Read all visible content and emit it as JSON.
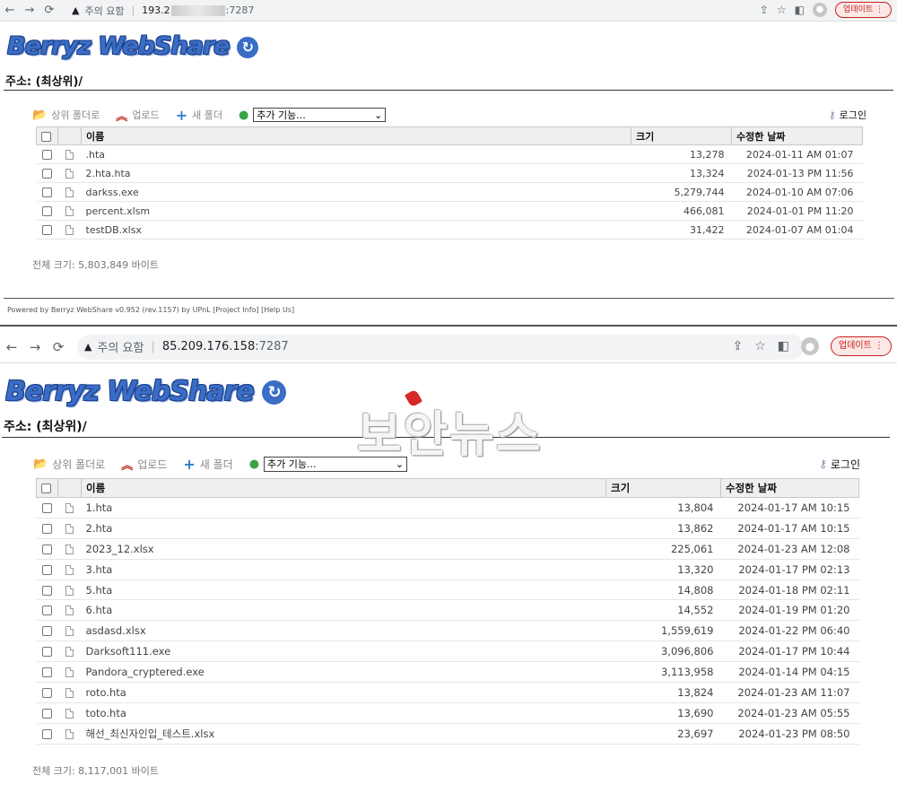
{
  "shot1": {
    "browser": {
      "nav": {
        "back": "←",
        "forward": "→",
        "reload": "⟳"
      },
      "warning_label": "주의 요함",
      "host": "193.2",
      "port": ":7287",
      "update_label": "업데이트",
      "menu": "⋮"
    },
    "logo": {
      "text": "Berryz WebShare",
      "swirl": "↻"
    },
    "address": "주소: (최상위)/",
    "toolbar": {
      "parent": "상위 폴더로",
      "upload": "업로드",
      "new_folder": "새 폴더",
      "more": "추가 기능...",
      "login": "로그인"
    },
    "table": {
      "headers": {
        "name": "이름",
        "size": "크기",
        "date": "수정한 날짜"
      },
      "rows": [
        {
          "name": ".hta",
          "size": "13,278",
          "date": "2024-01-11 AM 01:07"
        },
        {
          "name": "2.hta.hta",
          "size": "13,324",
          "date": "2024-01-13 PM 11:56"
        },
        {
          "name": "darkss.exe",
          "size": "5,279,744",
          "date": "2024-01-10 AM 07:06"
        },
        {
          "name": "percent.xlsm",
          "size": "466,081",
          "date": "2024-01-01 PM 11:20"
        },
        {
          "name": "testDB.xlsx",
          "size": "31,422",
          "date": "2024-01-07 AM 01:04"
        }
      ]
    },
    "total": "전체 크기: 5,803,849 바이트",
    "footer": "Powered by Berryz WebShare v0.952 (rev.1157) by UPnL [Project Info] [Help Us]"
  },
  "shot2": {
    "browser": {
      "nav": {
        "back": "←",
        "forward": "→",
        "reload": "⟳"
      },
      "warning_label": "주의 요함",
      "host": "85.209.176.158",
      "port": ":7287",
      "update_label": "업데이트",
      "menu": "⋮"
    },
    "logo": {
      "text": "Berryz WebShare",
      "swirl": "↻"
    },
    "address": "주소: (최상위)/",
    "toolbar": {
      "parent": "상위 폴더로",
      "upload": "업로드",
      "new_folder": "새 폴더",
      "more": "추가 기능...",
      "login": "로그인"
    },
    "table": {
      "headers": {
        "name": "이름",
        "size": "크기",
        "date": "수정한 날짜"
      },
      "rows": [
        {
          "name": "1.hta",
          "size": "13,804",
          "date": "2024-01-17 AM 10:15"
        },
        {
          "name": "2.hta",
          "size": "13,862",
          "date": "2024-01-17 AM 10:15"
        },
        {
          "name": "2023_12.xlsx",
          "size": "225,061",
          "date": "2024-01-23 AM 12:08"
        },
        {
          "name": "3.hta",
          "size": "13,320",
          "date": "2024-01-17 PM 02:13"
        },
        {
          "name": "5.hta",
          "size": "14,808",
          "date": "2024-01-18 PM 02:11"
        },
        {
          "name": "6.hta",
          "size": "14,552",
          "date": "2024-01-19 PM 01:20"
        },
        {
          "name": "asdasd.xlsx",
          "size": "1,559,619",
          "date": "2024-01-22 PM 06:40"
        },
        {
          "name": "Darksoft111.exe",
          "size": "3,096,806",
          "date": "2024-01-17 PM 10:44"
        },
        {
          "name": "Pandora_cryptered.exe",
          "size": "3,113,958",
          "date": "2024-01-14 PM 04:15"
        },
        {
          "name": "roto.hta",
          "size": "13,824",
          "date": "2024-01-23 AM 11:07"
        },
        {
          "name": "toto.hta",
          "size": "13,690",
          "date": "2024-01-23 AM 05:55"
        },
        {
          "name": "해선_최신자인입_테스트.xlsx",
          "size": "23,697",
          "date": "2024-01-23 PM 08:50"
        }
      ]
    },
    "total": "전체 크기: 8,117,001 바이트"
  },
  "watermark": "보안뉴스",
  "colors": {
    "accent": "#3a6dc5",
    "update_red": "#c5221f",
    "watermark_red": "#d62828"
  }
}
